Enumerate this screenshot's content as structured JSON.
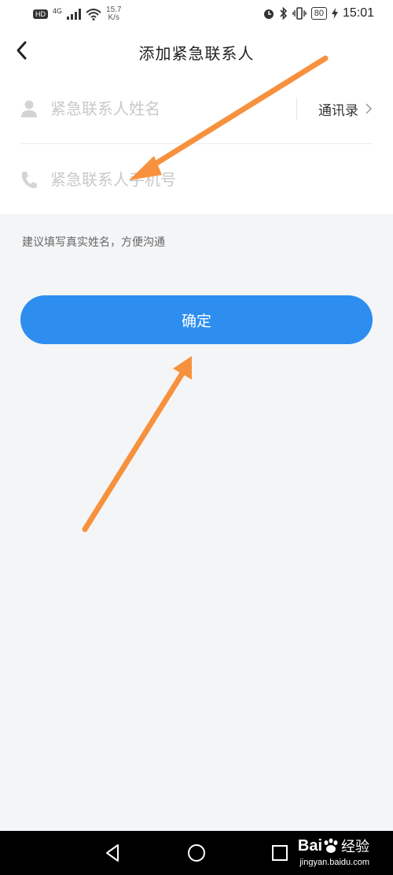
{
  "status_bar": {
    "hd": "HD",
    "network": "4G",
    "speed_value": "15.7",
    "speed_unit": "K/s",
    "battery": "80",
    "time": "15:01"
  },
  "header": {
    "title": "添加紧急联系人"
  },
  "form": {
    "name_placeholder": "紧急联系人姓名",
    "contacts_label": "通讯录",
    "phone_placeholder": "紧急联系人手机号"
  },
  "hint": "建议填写真实姓名，方便沟通",
  "confirm_label": "确定",
  "watermark": {
    "brand_left": "Bai",
    "brand_right": "经验",
    "url": "jingyan.baidu.com"
  },
  "colors": {
    "accent": "#2d8ef0",
    "annotation_arrow": "#f7913d",
    "background": "#f4f5f7"
  },
  "icons": [
    "back-arrow-icon",
    "person-icon",
    "phone-icon",
    "chevron-right-icon",
    "nav-back-icon",
    "nav-home-icon",
    "nav-recents-icon"
  ]
}
